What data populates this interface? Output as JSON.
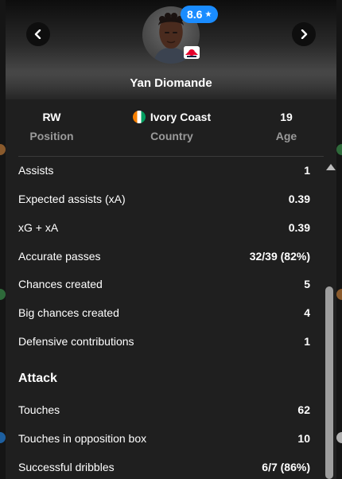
{
  "player": {
    "name": "Yan Diomande",
    "rating": "8.6",
    "rating_icon": "star-icon"
  },
  "info": {
    "position": {
      "value": "RW",
      "label": "Position"
    },
    "country": {
      "value": "Ivory Coast",
      "label": "Country"
    },
    "age": {
      "value": "19",
      "label": "Age"
    }
  },
  "stats": [
    {
      "label": "Assists",
      "value": "1"
    },
    {
      "label": "Expected assists (xA)",
      "value": "0.39"
    },
    {
      "label": "xG + xA",
      "value": "0.39"
    },
    {
      "label": "Accurate passes",
      "value": "32/39 (82%)"
    },
    {
      "label": "Chances created",
      "value": "5"
    },
    {
      "label": "Big chances created",
      "value": "4"
    },
    {
      "label": "Defensive contributions",
      "value": "1"
    }
  ],
  "attack": {
    "title": "Attack",
    "stats": [
      {
        "label": "Touches",
        "value": "62"
      },
      {
        "label": "Touches in opposition box",
        "value": "10"
      },
      {
        "label": "Successful dribbles",
        "value": "6/7 (86%)"
      }
    ]
  },
  "colors": {
    "badge": "#1a8cff",
    "background": "#1f1f1f",
    "muted_text": "#9a9a9a"
  }
}
